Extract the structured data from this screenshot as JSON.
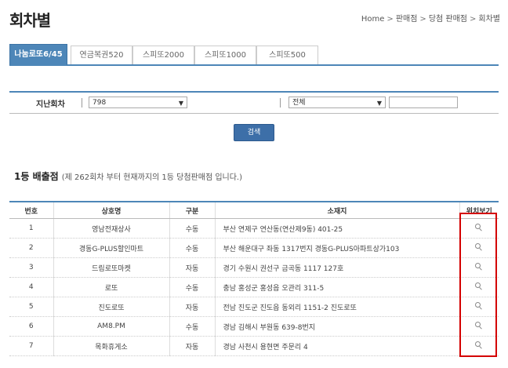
{
  "page": {
    "title": "회차별",
    "breadcrumb": [
      "Home",
      "판매점",
      "당첨 판매점",
      "회차별"
    ]
  },
  "tabs": [
    "나눔로또6/45",
    "연금복권520",
    "스피또2000",
    "스피또1000",
    "스피또500"
  ],
  "filter": {
    "label": "지난회차",
    "round_value": "798",
    "region_value": "전체",
    "text_value": ""
  },
  "search_button": "검색",
  "section": {
    "heading": "1등 배출점",
    "note": "(제 262회차 부터 현재까지의 1등 당첨판매점 입니다.)"
  },
  "table": {
    "headers": [
      "번호",
      "상호명",
      "구분",
      "소재지",
      "위치보기"
    ],
    "rows": [
      {
        "no": "1",
        "name": "영남전재상사",
        "type": "수동",
        "address": "부산 연제구 연산동(연산제9동) 401-25"
      },
      {
        "no": "2",
        "name": "경동G-PLUS할인마트",
        "type": "수동",
        "address": "부산 해운대구 좌동 1317번지 경동G-PLUS아파트상가103"
      },
      {
        "no": "3",
        "name": "드림로또마켓",
        "type": "자동",
        "address": "경기 수원시 권선구 금곡동 1117 127호"
      },
      {
        "no": "4",
        "name": "로또",
        "type": "수동",
        "address": "충남 홍성군 홍성읍 오관리 311-5"
      },
      {
        "no": "5",
        "name": "진도로또",
        "type": "자동",
        "address": "전남 진도군 진도읍 동외리 1151-2 진도로또"
      },
      {
        "no": "6",
        "name": "AM8.PM",
        "type": "수동",
        "address": "경남 김해시 부원동 639-8번지"
      },
      {
        "no": "7",
        "name": "목화휴게소",
        "type": "자동",
        "address": "경남 사천시 용현면 주문리 4"
      }
    ]
  },
  "colors": {
    "accent": "#4d86b8",
    "highlight_box": "#d40000"
  },
  "icons": {
    "location": "magnifier-icon"
  }
}
